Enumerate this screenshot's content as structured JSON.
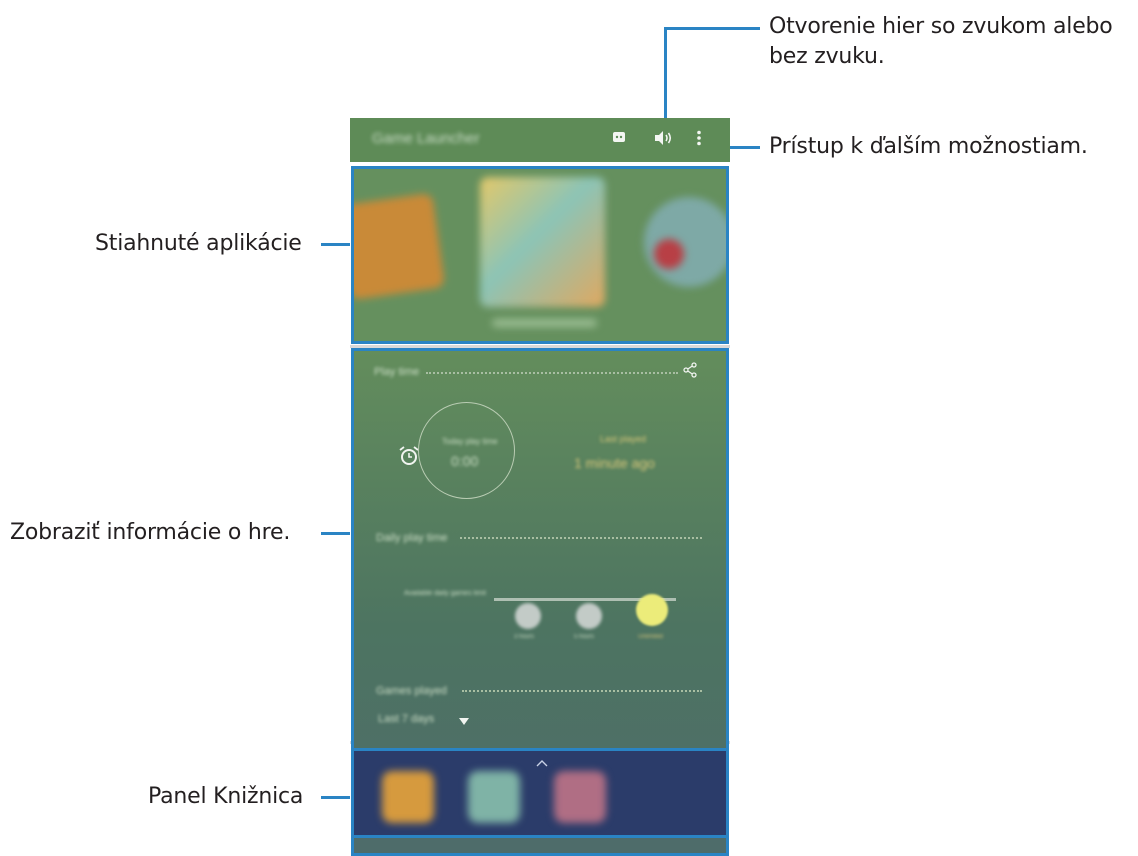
{
  "callouts": {
    "sound": [
      "Otvorenie hier so zvukom alebo",
      "bez zvuku."
    ],
    "more": "Prístup k ďalším možnostiam.",
    "apps": "Stiahnuté aplikácie",
    "info": "Zobraziť informácie o hre.",
    "library": "Panel Knižnica"
  },
  "screen": {
    "title": "Game Launcher",
    "toolbar_icons": [
      "discord-icon",
      "speaker-icon",
      "more-icon"
    ],
    "play_time_label": "Play time",
    "today_label": "Today play time",
    "today_value": "0:00",
    "last_played_label": "Last played",
    "last_played_value": "1 minute ago",
    "daily_label": "Daily play time",
    "limit_label": "Available daily games limit",
    "bubbles": [
      "3 hours",
      "5 hours",
      "Unlimited"
    ],
    "period_label": "Last 7 days",
    "colors": {
      "header": "#5e8b57",
      "library": "#2b3c6a",
      "accent": "#2a84c4"
    }
  }
}
